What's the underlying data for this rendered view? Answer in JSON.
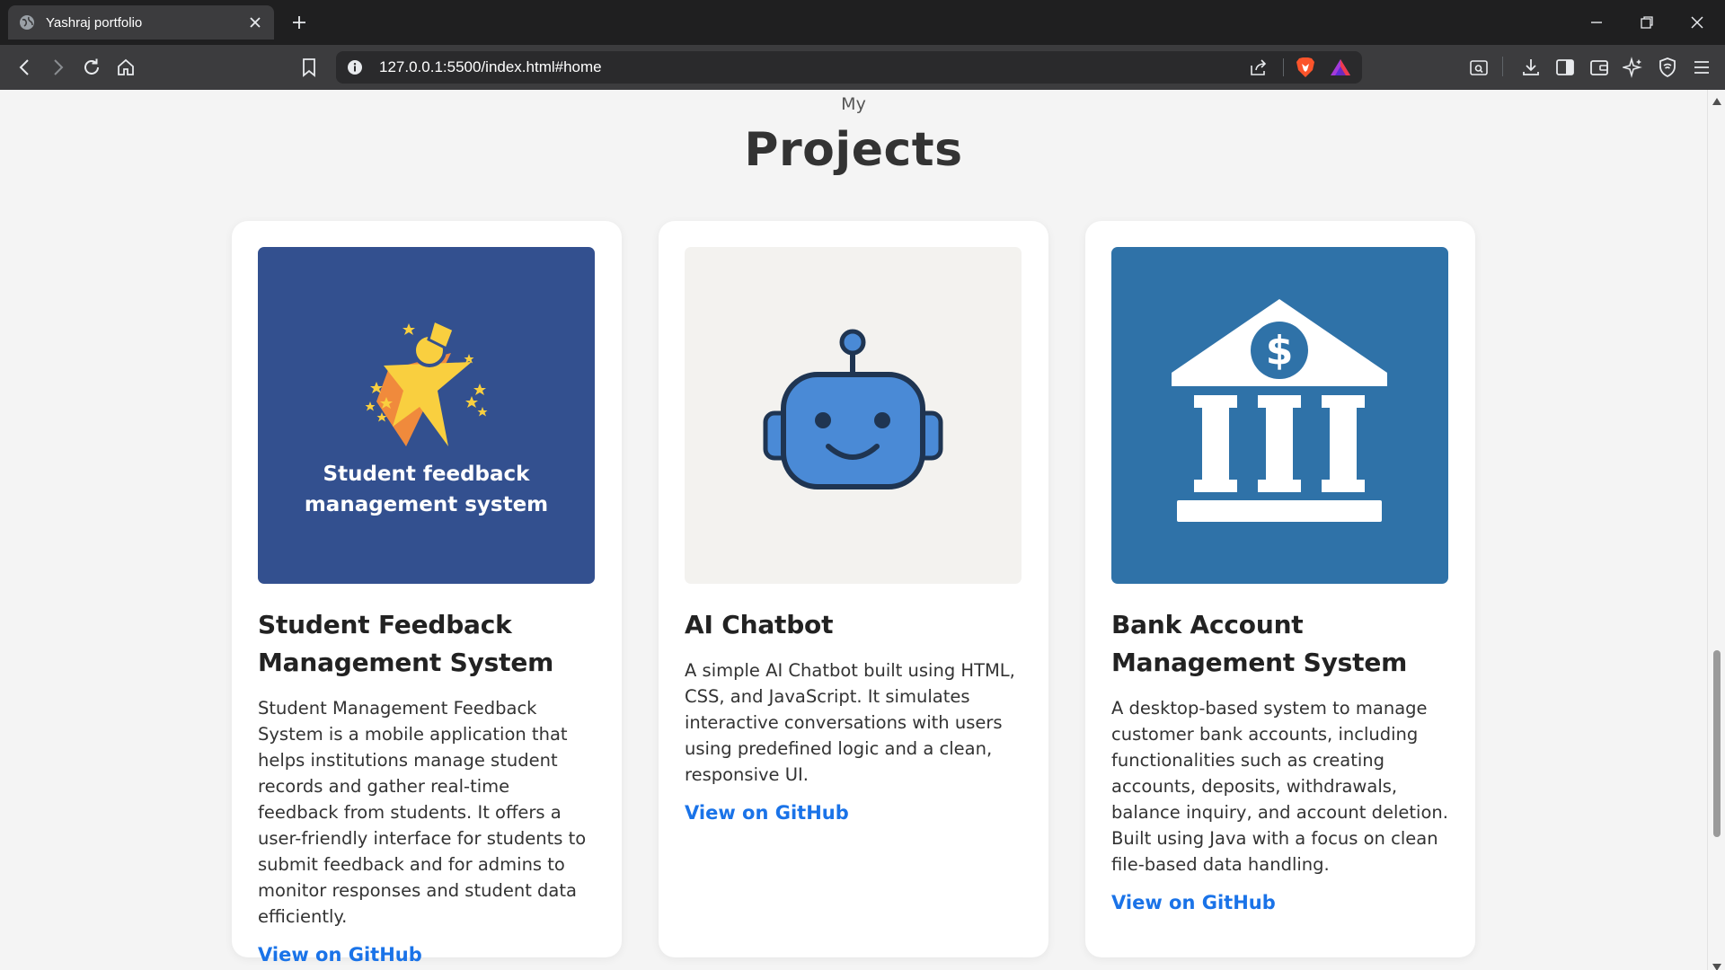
{
  "browser": {
    "tab": {
      "title": "Yashraj portfolio",
      "favicon": "globe-icon"
    },
    "url": "127.0.0.1:5500/index.html#home"
  },
  "section": {
    "pre_title": "My",
    "title": "Projects"
  },
  "projects": [
    {
      "image_icon": "student-feedback-logo",
      "image_caption": [
        "Student feedback",
        "management system"
      ],
      "image_bg": "#33508f",
      "title": "Student Feedback Management System",
      "description": "Student Management Feedback System is a mobile application that helps institutions manage student records and gather real-time feedback from students. It offers a user-friendly interface for students to submit feedback and for admins to monitor responses and student data efficiently.",
      "link": "View on GitHub"
    },
    {
      "image_icon": "robot-icon",
      "image_bg": "#f3f2ef",
      "title": "AI Chatbot",
      "description": "A simple AI Chatbot built using HTML, CSS, and JavaScript. It simulates interactive conversations with users using predefined logic and a clean, responsive UI.",
      "link": "View on GitHub"
    },
    {
      "image_icon": "bank-icon",
      "image_bg": "#2f72a8",
      "title": "Bank Account Management System",
      "description": "A desktop-based system to manage customer bank accounts, including functionalities such as creating accounts, deposits, withdrawals, balance inquiry, and account deletion. Built using Java with a focus on clean file-based data handling.",
      "link": "View on GitHub"
    }
  ],
  "colors": {
    "link": "#1a73e8",
    "page_bg": "#f4f4f4",
    "card_bg": "#ffffff"
  }
}
